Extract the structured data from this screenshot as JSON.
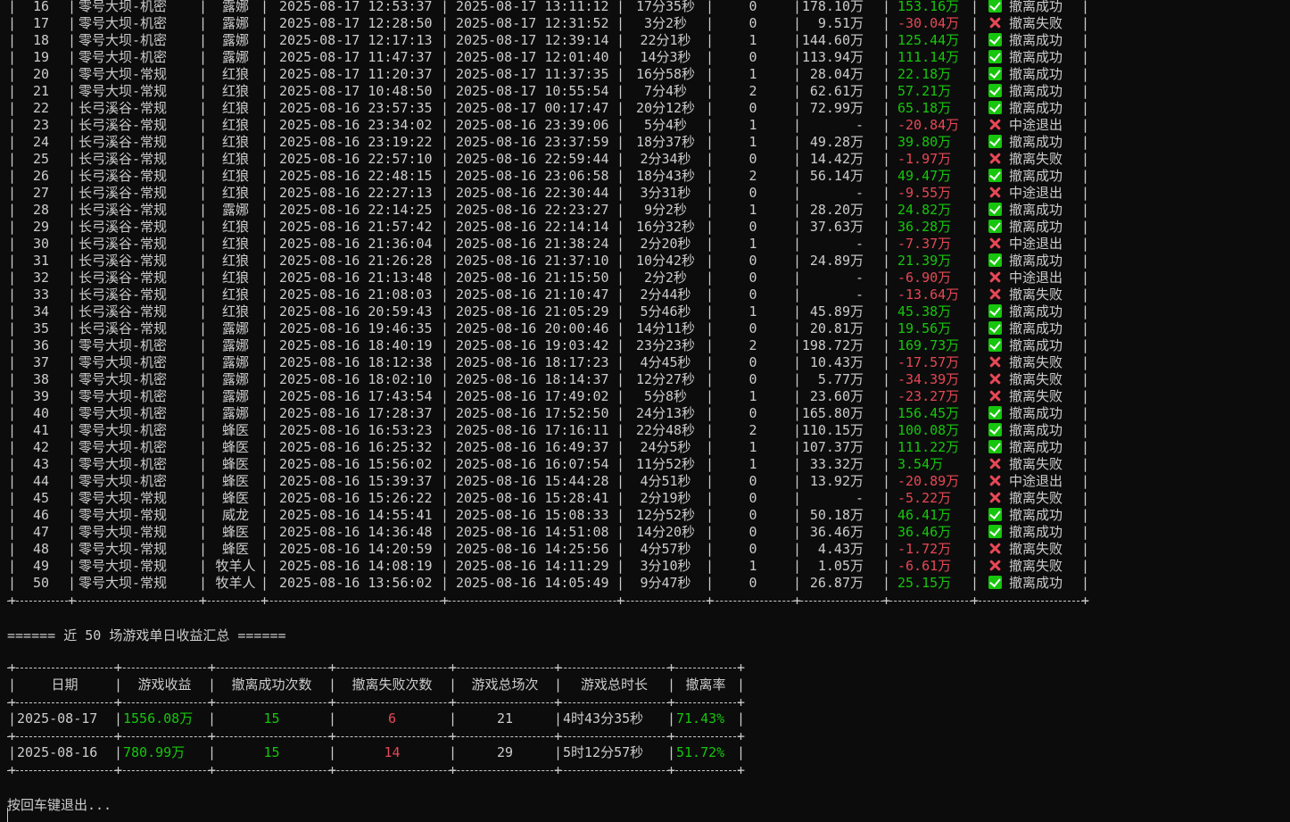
{
  "games_table": {
    "rows": [
      {
        "no": "16",
        "map": "零号大坝-机密",
        "hero": "露娜",
        "start": "2025-08-17 12:53:37",
        "end": "2025-08-17 13:11:12",
        "duration": "17分35秒",
        "kills": "0",
        "value": "178.10万",
        "profit": "153.16万",
        "profit_sign": "pos",
        "status_icon": "check",
        "status": "撤离成功"
      },
      {
        "no": "17",
        "map": "零号大坝-机密",
        "hero": "露娜",
        "start": "2025-08-17 12:28:50",
        "end": "2025-08-17 12:31:52",
        "duration": "3分2秒",
        "kills": "0",
        "value": "9.51万",
        "profit": "-30.04万",
        "profit_sign": "neg",
        "status_icon": "cross",
        "status": "撤离失败"
      },
      {
        "no": "18",
        "map": "零号大坝-机密",
        "hero": "露娜",
        "start": "2025-08-17 12:17:13",
        "end": "2025-08-17 12:39:14",
        "duration": "22分1秒",
        "kills": "1",
        "value": "144.60万",
        "profit": "125.44万",
        "profit_sign": "pos",
        "status_icon": "check",
        "status": "撤离成功"
      },
      {
        "no": "19",
        "map": "零号大坝-机密",
        "hero": "露娜",
        "start": "2025-08-17 11:47:37",
        "end": "2025-08-17 12:01:40",
        "duration": "14分3秒",
        "kills": "0",
        "value": "113.94万",
        "profit": "111.14万",
        "profit_sign": "pos",
        "status_icon": "check",
        "status": "撤离成功"
      },
      {
        "no": "20",
        "map": "零号大坝-常规",
        "hero": "红狼",
        "start": "2025-08-17 11:20:37",
        "end": "2025-08-17 11:37:35",
        "duration": "16分58秒",
        "kills": "1",
        "value": "28.04万",
        "profit": "22.18万",
        "profit_sign": "pos",
        "status_icon": "check",
        "status": "撤离成功"
      },
      {
        "no": "21",
        "map": "零号大坝-常规",
        "hero": "红狼",
        "start": "2025-08-17 10:48:50",
        "end": "2025-08-17 10:55:54",
        "duration": "7分4秒",
        "kills": "2",
        "value": "62.61万",
        "profit": "57.21万",
        "profit_sign": "pos",
        "status_icon": "check",
        "status": "撤离成功"
      },
      {
        "no": "22",
        "map": "长弓溪谷-常规",
        "hero": "红狼",
        "start": "2025-08-16 23:57:35",
        "end": "2025-08-17 00:17:47",
        "duration": "20分12秒",
        "kills": "0",
        "value": "72.99万",
        "profit": "65.18万",
        "profit_sign": "pos",
        "status_icon": "check",
        "status": "撤离成功"
      },
      {
        "no": "23",
        "map": "长弓溪谷-常规",
        "hero": "红狼",
        "start": "2025-08-16 23:34:02",
        "end": "2025-08-16 23:39:06",
        "duration": "5分4秒",
        "kills": "1",
        "value": "-",
        "profit": "-20.84万",
        "profit_sign": "neg",
        "status_icon": "cross",
        "status": "中途退出"
      },
      {
        "no": "24",
        "map": "长弓溪谷-常规",
        "hero": "红狼",
        "start": "2025-08-16 23:19:22",
        "end": "2025-08-16 23:37:59",
        "duration": "18分37秒",
        "kills": "1",
        "value": "49.28万",
        "profit": "39.80万",
        "profit_sign": "pos",
        "status_icon": "check",
        "status": "撤离成功"
      },
      {
        "no": "25",
        "map": "长弓溪谷-常规",
        "hero": "红狼",
        "start": "2025-08-16 22:57:10",
        "end": "2025-08-16 22:59:44",
        "duration": "2分34秒",
        "kills": "0",
        "value": "14.42万",
        "profit": "-1.97万",
        "profit_sign": "neg",
        "status_icon": "cross",
        "status": "撤离失败"
      },
      {
        "no": "26",
        "map": "长弓溪谷-常规",
        "hero": "红狼",
        "start": "2025-08-16 22:48:15",
        "end": "2025-08-16 23:06:58",
        "duration": "18分43秒",
        "kills": "2",
        "value": "56.14万",
        "profit": "49.47万",
        "profit_sign": "pos",
        "status_icon": "check",
        "status": "撤离成功"
      },
      {
        "no": "27",
        "map": "长弓溪谷-常规",
        "hero": "红狼",
        "start": "2025-08-16 22:27:13",
        "end": "2025-08-16 22:30:44",
        "duration": "3分31秒",
        "kills": "0",
        "value": "-",
        "profit": "-9.55万",
        "profit_sign": "neg",
        "status_icon": "cross",
        "status": "中途退出"
      },
      {
        "no": "28",
        "map": "长弓溪谷-常规",
        "hero": "露娜",
        "start": "2025-08-16 22:14:25",
        "end": "2025-08-16 22:23:27",
        "duration": "9分2秒",
        "kills": "1",
        "value": "28.20万",
        "profit": "24.82万",
        "profit_sign": "pos",
        "status_icon": "check",
        "status": "撤离成功"
      },
      {
        "no": "29",
        "map": "长弓溪谷-常规",
        "hero": "红狼",
        "start": "2025-08-16 21:57:42",
        "end": "2025-08-16 22:14:14",
        "duration": "16分32秒",
        "kills": "0",
        "value": "37.63万",
        "profit": "36.28万",
        "profit_sign": "pos",
        "status_icon": "check",
        "status": "撤离成功"
      },
      {
        "no": "30",
        "map": "长弓溪谷-常规",
        "hero": "红狼",
        "start": "2025-08-16 21:36:04",
        "end": "2025-08-16 21:38:24",
        "duration": "2分20秒",
        "kills": "1",
        "value": "-",
        "profit": "-7.37万",
        "profit_sign": "neg",
        "status_icon": "cross",
        "status": "中途退出"
      },
      {
        "no": "31",
        "map": "长弓溪谷-常规",
        "hero": "红狼",
        "start": "2025-08-16 21:26:28",
        "end": "2025-08-16 21:37:10",
        "duration": "10分42秒",
        "kills": "0",
        "value": "24.89万",
        "profit": "21.39万",
        "profit_sign": "pos",
        "status_icon": "check",
        "status": "撤离成功"
      },
      {
        "no": "32",
        "map": "长弓溪谷-常规",
        "hero": "红狼",
        "start": "2025-08-16 21:13:48",
        "end": "2025-08-16 21:15:50",
        "duration": "2分2秒",
        "kills": "0",
        "value": "-",
        "profit": "-6.90万",
        "profit_sign": "neg",
        "status_icon": "cross",
        "status": "中途退出"
      },
      {
        "no": "33",
        "map": "长弓溪谷-常规",
        "hero": "红狼",
        "start": "2025-08-16 21:08:03",
        "end": "2025-08-16 21:10:47",
        "duration": "2分44秒",
        "kills": "0",
        "value": "-",
        "profit": "-13.64万",
        "profit_sign": "neg",
        "status_icon": "cross",
        "status": "撤离失败"
      },
      {
        "no": "34",
        "map": "长弓溪谷-常规",
        "hero": "红狼",
        "start": "2025-08-16 20:59:43",
        "end": "2025-08-16 21:05:29",
        "duration": "5分46秒",
        "kills": "1",
        "value": "45.89万",
        "profit": "45.38万",
        "profit_sign": "pos",
        "status_icon": "check",
        "status": "撤离成功"
      },
      {
        "no": "35",
        "map": "长弓溪谷-常规",
        "hero": "露娜",
        "start": "2025-08-16 19:46:35",
        "end": "2025-08-16 20:00:46",
        "duration": "14分11秒",
        "kills": "0",
        "value": "20.81万",
        "profit": "19.56万",
        "profit_sign": "pos",
        "status_icon": "check",
        "status": "撤离成功"
      },
      {
        "no": "36",
        "map": "零号大坝-机密",
        "hero": "露娜",
        "start": "2025-08-16 18:40:19",
        "end": "2025-08-16 19:03:42",
        "duration": "23分23秒",
        "kills": "2",
        "value": "198.72万",
        "profit": "169.73万",
        "profit_sign": "pos",
        "status_icon": "check",
        "status": "撤离成功"
      },
      {
        "no": "37",
        "map": "零号大坝-机密",
        "hero": "露娜",
        "start": "2025-08-16 18:12:38",
        "end": "2025-08-16 18:17:23",
        "duration": "4分45秒",
        "kills": "0",
        "value": "10.43万",
        "profit": "-17.57万",
        "profit_sign": "neg",
        "status_icon": "cross",
        "status": "撤离失败"
      },
      {
        "no": "38",
        "map": "零号大坝-机密",
        "hero": "露娜",
        "start": "2025-08-16 18:02:10",
        "end": "2025-08-16 18:14:37",
        "duration": "12分27秒",
        "kills": "0",
        "value": "5.77万",
        "profit": "-34.39万",
        "profit_sign": "neg",
        "status_icon": "cross",
        "status": "撤离失败"
      },
      {
        "no": "39",
        "map": "零号大坝-机密",
        "hero": "露娜",
        "start": "2025-08-16 17:43:54",
        "end": "2025-08-16 17:49:02",
        "duration": "5分8秒",
        "kills": "1",
        "value": "23.60万",
        "profit": "-23.27万",
        "profit_sign": "neg",
        "status_icon": "cross",
        "status": "撤离失败"
      },
      {
        "no": "40",
        "map": "零号大坝-机密",
        "hero": "露娜",
        "start": "2025-08-16 17:28:37",
        "end": "2025-08-16 17:52:50",
        "duration": "24分13秒",
        "kills": "0",
        "value": "165.80万",
        "profit": "156.45万",
        "profit_sign": "pos",
        "status_icon": "check",
        "status": "撤离成功"
      },
      {
        "no": "41",
        "map": "零号大坝-机密",
        "hero": "蜂医",
        "start": "2025-08-16 16:53:23",
        "end": "2025-08-16 17:16:11",
        "duration": "22分48秒",
        "kills": "2",
        "value": "110.15万",
        "profit": "100.08万",
        "profit_sign": "pos",
        "status_icon": "check",
        "status": "撤离成功"
      },
      {
        "no": "42",
        "map": "零号大坝-机密",
        "hero": "蜂医",
        "start": "2025-08-16 16:25:32",
        "end": "2025-08-16 16:49:37",
        "duration": "24分5秒",
        "kills": "1",
        "value": "107.37万",
        "profit": "111.22万",
        "profit_sign": "pos",
        "status_icon": "check",
        "status": "撤离成功"
      },
      {
        "no": "43",
        "map": "零号大坝-机密",
        "hero": "蜂医",
        "start": "2025-08-16 15:56:02",
        "end": "2025-08-16 16:07:54",
        "duration": "11分52秒",
        "kills": "1",
        "value": "33.32万",
        "profit": "3.54万",
        "profit_sign": "pos",
        "status_icon": "cross",
        "status": "撤离失败"
      },
      {
        "no": "44",
        "map": "零号大坝-机密",
        "hero": "蜂医",
        "start": "2025-08-16 15:39:37",
        "end": "2025-08-16 15:44:28",
        "duration": "4分51秒",
        "kills": "0",
        "value": "13.92万",
        "profit": "-20.89万",
        "profit_sign": "neg",
        "status_icon": "cross",
        "status": "中途退出"
      },
      {
        "no": "45",
        "map": "零号大坝-常规",
        "hero": "蜂医",
        "start": "2025-08-16 15:26:22",
        "end": "2025-08-16 15:28:41",
        "duration": "2分19秒",
        "kills": "0",
        "value": "-",
        "profit": "-5.22万",
        "profit_sign": "neg",
        "status_icon": "cross",
        "status": "撤离失败"
      },
      {
        "no": "46",
        "map": "零号大坝-常规",
        "hero": "威龙",
        "start": "2025-08-16 14:55:41",
        "end": "2025-08-16 15:08:33",
        "duration": "12分52秒",
        "kills": "0",
        "value": "50.18万",
        "profit": "46.41万",
        "profit_sign": "pos",
        "status_icon": "check",
        "status": "撤离成功"
      },
      {
        "no": "47",
        "map": "零号大坝-常规",
        "hero": "蜂医",
        "start": "2025-08-16 14:36:48",
        "end": "2025-08-16 14:51:08",
        "duration": "14分20秒",
        "kills": "0",
        "value": "36.46万",
        "profit": "36.46万",
        "profit_sign": "pos",
        "status_icon": "check",
        "status": "撤离成功"
      },
      {
        "no": "48",
        "map": "零号大坝-常规",
        "hero": "蜂医",
        "start": "2025-08-16 14:20:59",
        "end": "2025-08-16 14:25:56",
        "duration": "4分57秒",
        "kills": "0",
        "value": "4.43万",
        "profit": "-1.72万",
        "profit_sign": "neg",
        "status_icon": "cross",
        "status": "撤离失败"
      },
      {
        "no": "49",
        "map": "零号大坝-常规",
        "hero": "牧羊人",
        "start": "2025-08-16 14:08:19",
        "end": "2025-08-16 14:11:29",
        "duration": "3分10秒",
        "kills": "1",
        "value": "1.05万",
        "profit": "-6.61万",
        "profit_sign": "neg",
        "status_icon": "cross",
        "status": "撤离失败"
      },
      {
        "no": "50",
        "map": "零号大坝-常规",
        "hero": "牧羊人",
        "start": "2025-08-16 13:56:02",
        "end": "2025-08-16 14:05:49",
        "duration": "9分47秒",
        "kills": "0",
        "value": "26.87万",
        "profit": "25.15万",
        "profit_sign": "pos",
        "status_icon": "check",
        "status": "撤离成功"
      }
    ]
  },
  "summary": {
    "heading": "====== 近 50 场游戏单日收益汇总 ======",
    "headers": [
      "日期",
      "游戏收益",
      "撤离成功次数",
      "撤离失败次数",
      "游戏总场次",
      "游戏总时长",
      "撤离率"
    ],
    "rows": [
      {
        "date": "2025-08-17",
        "profit": "1556.08万",
        "success": "15",
        "fail": "6",
        "total": "21",
        "duration": "4时43分35秒",
        "rate": "71.43%"
      },
      {
        "date": "2025-08-16",
        "profit": "780.99万",
        "success": "15",
        "fail": "14",
        "total": "29",
        "duration": "5时12分57秒",
        "rate": "51.72%"
      }
    ]
  },
  "prompt": {
    "text": "按回车键退出..."
  },
  "colors": {
    "background": "#0c0c0c",
    "text": "#cccccc",
    "positive": "#16c60c",
    "negative": "#e74856"
  }
}
